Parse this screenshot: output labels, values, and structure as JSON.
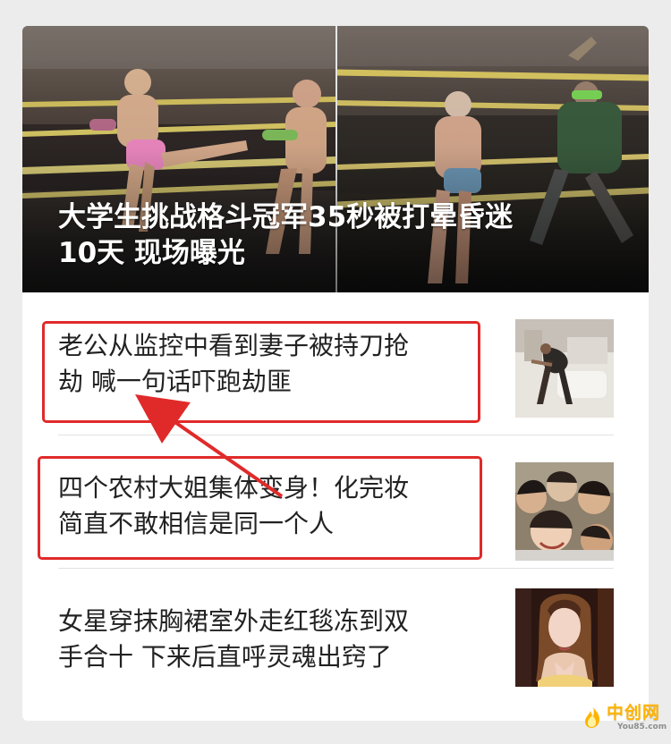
{
  "feed": {
    "headline": {
      "title": "大学生挑战格斗冠军35秒被打晕昏迷\n10天 现场曝光"
    },
    "items": [
      {
        "title": "老公从监控中看到妻子被持刀抢\n劫 喊一句话吓跑劫匪",
        "highlighted": true
      },
      {
        "title": "四个农村大姐集体变身！化完妆\n简直不敢相信是同一个人",
        "highlighted": true
      },
      {
        "title": "女星穿抹胸裙室外走红毯冻到双\n手合十 下来后直呼灵魂出窍了",
        "highlighted": false
      }
    ]
  },
  "watermark": {
    "name": "中创网",
    "domain": "You85.com"
  },
  "colors": {
    "annotation_red": "#e02a2a",
    "background": "#ececec",
    "card_background": "#ffffff",
    "logo_orange": "#ffb300"
  }
}
